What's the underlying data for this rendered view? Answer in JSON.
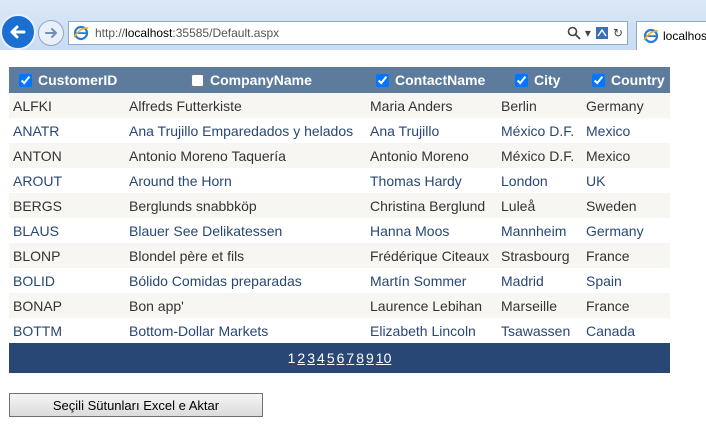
{
  "browser": {
    "url_prefix": "http://",
    "url_host": "localhost",
    "url_rest": ":35585/Default.aspx",
    "tab_title": "localhost"
  },
  "grid": {
    "columns": [
      {
        "label": "CustomerID",
        "checked": true
      },
      {
        "label": "CompanyName",
        "checked": false
      },
      {
        "label": "ContactName",
        "checked": true
      },
      {
        "label": "City",
        "checked": true
      },
      {
        "label": "Country",
        "checked": true
      }
    ],
    "rows": [
      [
        "ALFKI",
        "Alfreds Futterkiste",
        "Maria Anders",
        "Berlin",
        "Germany"
      ],
      [
        "ANATR",
        "Ana Trujillo Emparedados y helados",
        "Ana Trujillo",
        "México D.F.",
        "Mexico"
      ],
      [
        "ANTON",
        "Antonio Moreno Taquería",
        "Antonio Moreno",
        "México D.F.",
        "Mexico"
      ],
      [
        "AROUT",
        "Around the Horn",
        "Thomas Hardy",
        "London",
        "UK"
      ],
      [
        "BERGS",
        "Berglunds snabbköp",
        "Christina Berglund",
        "Luleå",
        "Sweden"
      ],
      [
        "BLAUS",
        "Blauer See Delikatessen",
        "Hanna Moos",
        "Mannheim",
        "Germany"
      ],
      [
        "BLONP",
        "Blondel père et fils",
        "Frédérique Citeaux",
        "Strasbourg",
        "France"
      ],
      [
        "BOLID",
        "Bólido Comidas preparadas",
        "Martín Sommer",
        "Madrid",
        "Spain"
      ],
      [
        "BONAP",
        "Bon app'",
        "Laurence Lebihan",
        "Marseille",
        "France"
      ],
      [
        "BOTTM",
        "Bottom-Dollar Markets",
        "Elizabeth Lincoln",
        "Tsawassen",
        "Canada"
      ]
    ],
    "pager": {
      "current": "1",
      "pages": [
        "2",
        "3",
        "4",
        "5",
        "6",
        "7",
        "8",
        "9",
        "10"
      ]
    }
  },
  "export_button_label": "Seçili Sütunları Excel e Aktar",
  "colors": {
    "header_bg": "#5d7b9d",
    "pager_bg": "#284775",
    "row_odd_bg": "#f7f6f3",
    "row_even_text": "#284775"
  }
}
